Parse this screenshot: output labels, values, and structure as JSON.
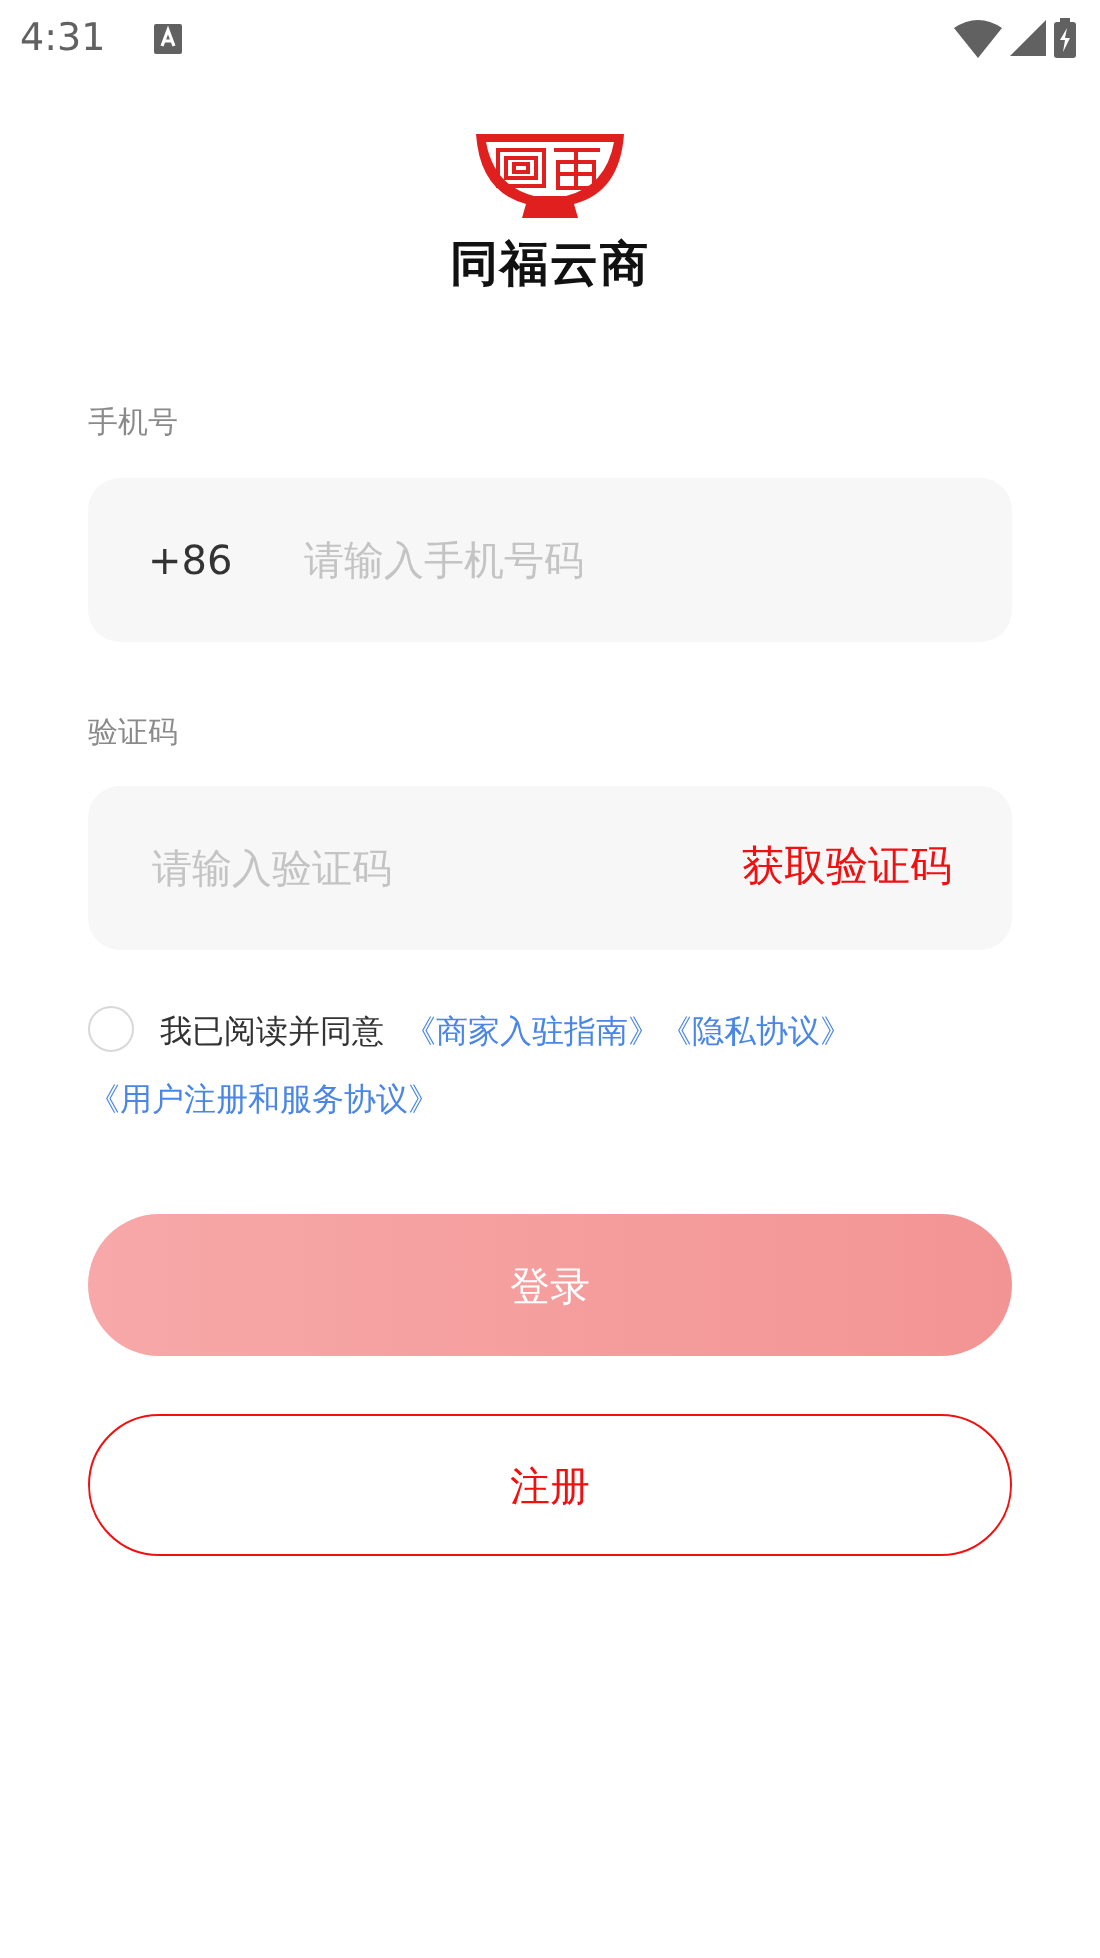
{
  "status_bar": {
    "time": "4:31"
  },
  "logo": {
    "name": "同福云商"
  },
  "phone": {
    "label": "手机号",
    "prefix": "+86",
    "placeholder": "请输入手机号码"
  },
  "code": {
    "label": "验证码",
    "placeholder": "请输入验证码",
    "action": "获取验证码"
  },
  "agreement": {
    "checked": false,
    "text": "我已阅读并同意",
    "links": [
      "《商家入驻指南》",
      "《隐私协议》",
      "《用户注册和服务协议》"
    ]
  },
  "buttons": [
    {
      "label": "登录",
      "kind": "primary",
      "disabled": true
    },
    {
      "label": "注册",
      "kind": "outline",
      "disabled": false
    }
  ]
}
